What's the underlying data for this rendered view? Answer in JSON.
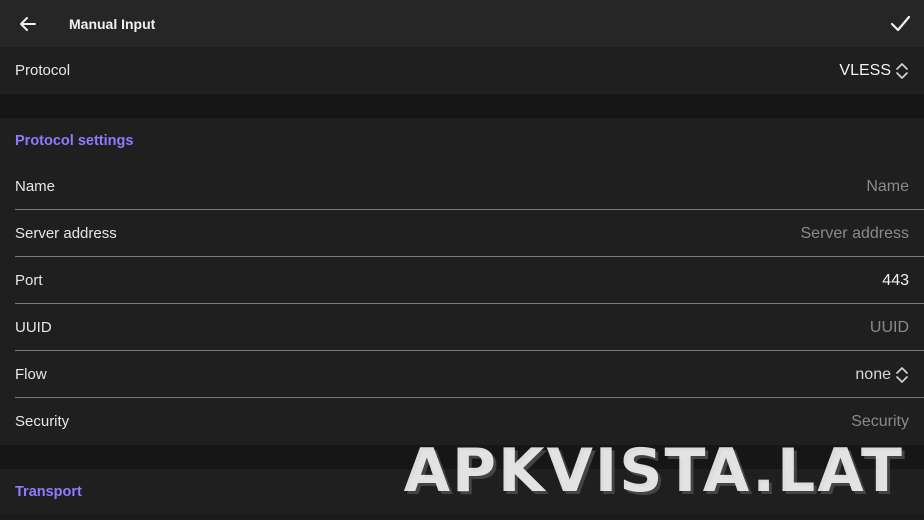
{
  "header": {
    "title": "Manual Input",
    "back_icon": "arrow-left-icon",
    "confirm_icon": "check-icon"
  },
  "protocol": {
    "label": "Protocol",
    "value": "VLESS"
  },
  "protocol_settings": {
    "header": "Protocol settings",
    "fields": {
      "name": {
        "label": "Name",
        "placeholder": "Name"
      },
      "server_address": {
        "label": "Server address",
        "placeholder": "Server address"
      },
      "port": {
        "label": "Port",
        "value": "443"
      },
      "uuid": {
        "label": "UUID",
        "placeholder": "UUID"
      },
      "flow": {
        "label": "Flow",
        "value": "none"
      },
      "security": {
        "label": "Security",
        "placeholder": "Security"
      }
    }
  },
  "transport": {
    "header": "Transport"
  },
  "watermark": "APKVISTA.LAT",
  "colors": {
    "accent": "#8f7bff",
    "background": "#1b1b1b",
    "topbar": "#262626"
  }
}
